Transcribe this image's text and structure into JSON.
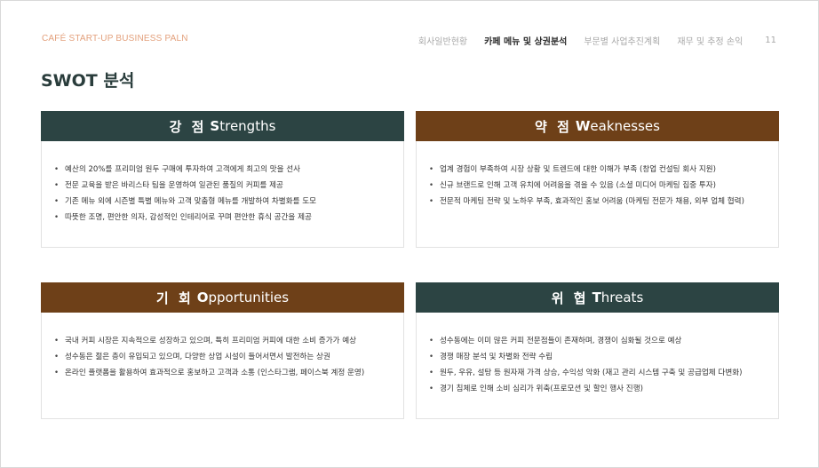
{
  "header": {
    "brand": "CAFÉ START-UP BUSINESS PALN",
    "nav": [
      "회사일반현황",
      "카페 메뉴 및 상권분석",
      "부문별 사업추진계획",
      "재무 및 추정 손익"
    ],
    "active_nav_index": 1,
    "page_number": "11"
  },
  "title": "SWOT 분석",
  "colors": {
    "dark_teal": "#2c4443",
    "brown": "#6e4018",
    "brand": "#e3a07c"
  },
  "swot": {
    "strengths": {
      "ko": "강 점",
      "cap": "S",
      "rest": "trengths",
      "items": [
        "예산의 20%를 프리미엄 원두 구매에 투자하여 고객에게 최고의 맛을 선사",
        "전문 교육을 받은 바리스타 팀을 운영하여 일관된 품질의 커피를 제공",
        "기존 메뉴 외에 시즌별 특별 메뉴와 고객 맞춤형 메뉴를 개발하여 차별화를 도모",
        "따뜻한 조명, 편안한 의자, 감성적인 인테리어로 꾸며 편안한 휴식 공간을 제공"
      ]
    },
    "weaknesses": {
      "ko": "약 점",
      "cap": "W",
      "rest": "eaknesses",
      "items": [
        "업계 경험이 부족하여 시장 상황 및 트렌드에 대한 이해가 부족 (창업 컨설팅 회사 지원)",
        "신규 브랜드로 인해 고객 유치에 어려움을 겪을 수 있음 (소셜 미디어 마케팅 집중 투자)",
        "전문적 마케팅 전략 및 노하우 부족, 효과적인 홍보 어려움 (마케팅 전문가 채용, 외부 업체 협력)"
      ]
    },
    "opportunities": {
      "ko": "기 회",
      "cap": "O",
      "rest": "pportunities",
      "items": [
        "국내 커피 시장은 지속적으로 성장하고 있으며, 특히 프리미엄 커피에 대한 소비 증가가 예상",
        "성수동은 젊은 층이 유입되고 있으며, 다양한 상업 시설이 들어서면서 발전하는 상권",
        "온라인 플랫폼을 활용하여 효과적으로 홍보하고 고객과 소통 (인스타그램, 페이스북 계정 운영)"
      ]
    },
    "threats": {
      "ko": "위 협",
      "cap": "T",
      "rest": "hreats",
      "items": [
        "성수동에는 이미 많은 커피 전문점들이 존재하며, 경쟁이 심화될 것으로 예상",
        "경쟁 매장 분석 및 차별화 전략 수립",
        "원두, 우유, 설탕 등 원자재 가격 상승, 수익성 악화 (재고 관리 시스템 구축 및 공급업체 다변화)",
        "경기 침체로 인해 소비 심리가 위축(프로모션 및 할인 행사 진행)"
      ]
    }
  }
}
